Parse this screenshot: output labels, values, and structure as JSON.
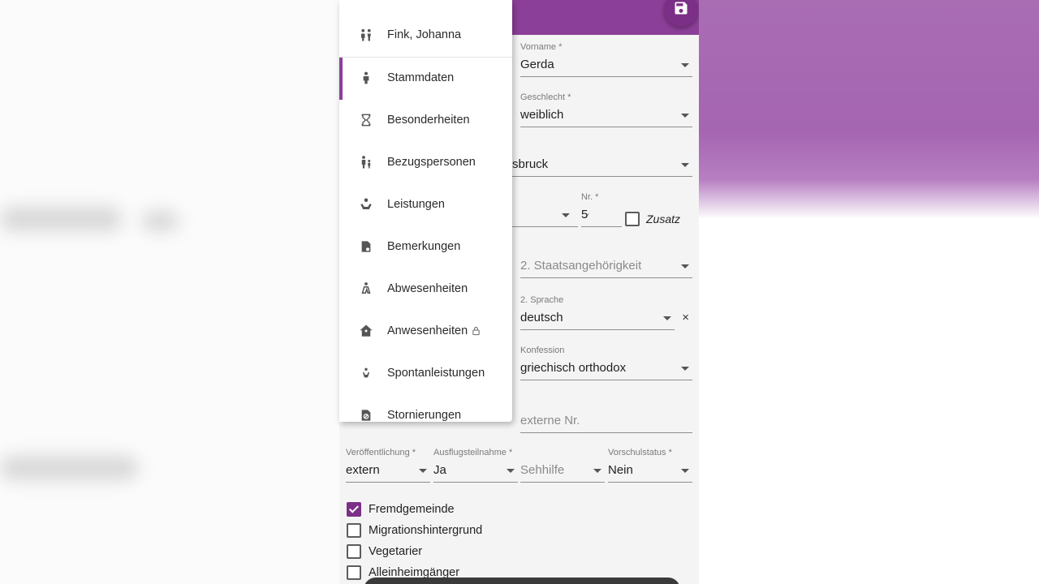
{
  "colors": {
    "accent": "#8c3f98",
    "accent_dark": "#7b2f86",
    "background_purple": "#a565b1"
  },
  "menu": {
    "items": [
      {
        "label": "Fink, Johanna",
        "icon": "people-icon",
        "active": false
      },
      {
        "label": "Stammdaten",
        "icon": "person-icon",
        "active": true
      },
      {
        "label": "Besonderheiten",
        "icon": "hourglass-icon",
        "active": false
      },
      {
        "label": "Bezugspersonen",
        "icon": "parent-child-icon",
        "active": false
      },
      {
        "label": "Leistungen",
        "icon": "service-hand-icon",
        "active": false
      },
      {
        "label": "Bemerkungen",
        "icon": "document-note-icon",
        "active": false
      },
      {
        "label": "Abwesenheiten",
        "icon": "person-away-icon",
        "active": false
      },
      {
        "label": "Anwesenheiten",
        "icon": "house-person-icon",
        "active": false,
        "locked": true
      },
      {
        "label": "Spontanleistungen",
        "icon": "spontaneous-service-icon",
        "active": false
      },
      {
        "label": "Stornierungen",
        "icon": "cancel-document-icon",
        "active": false
      }
    ]
  },
  "form": {
    "vorname": {
      "label": "Vorname *",
      "value": "Gerda"
    },
    "geschlecht": {
      "label": "Geschlecht *",
      "value": "weiblich"
    },
    "ort": {
      "value": "sbruck"
    },
    "nr": {
      "label": "Nr. *",
      "value": "5"
    },
    "zusatz": {
      "label": "Zusatz",
      "checked": false
    },
    "staatsangehoerigkeit2": {
      "placeholder": "2. Staatsangehörigkeit"
    },
    "sprache2": {
      "label": "2. Sprache",
      "value": "deutsch"
    },
    "konfession": {
      "label": "Konfession",
      "value": "griechisch orthodox"
    },
    "externe_nr": {
      "placeholder": "externe Nr."
    },
    "veroeffentlichung": {
      "label": "Veröffentlichung *",
      "value": "extern"
    },
    "ausflugsteilnahme": {
      "label": "Ausflugsteilnahme *",
      "value": "Ja"
    },
    "sehhilfe": {
      "placeholder": "Sehhilfe"
    },
    "vorschulstatus": {
      "label": "Vorschulstatus *",
      "value": "Nein"
    }
  },
  "checkboxes": [
    {
      "label": "Fremdgemeinde",
      "checked": true
    },
    {
      "label": "Migrationshintergrund",
      "checked": false
    },
    {
      "label": "Vegetarier",
      "checked": false
    },
    {
      "label": "Alleinheimgänger",
      "checked": false
    }
  ],
  "toolbar": {
    "save_icon": "save-icon"
  }
}
